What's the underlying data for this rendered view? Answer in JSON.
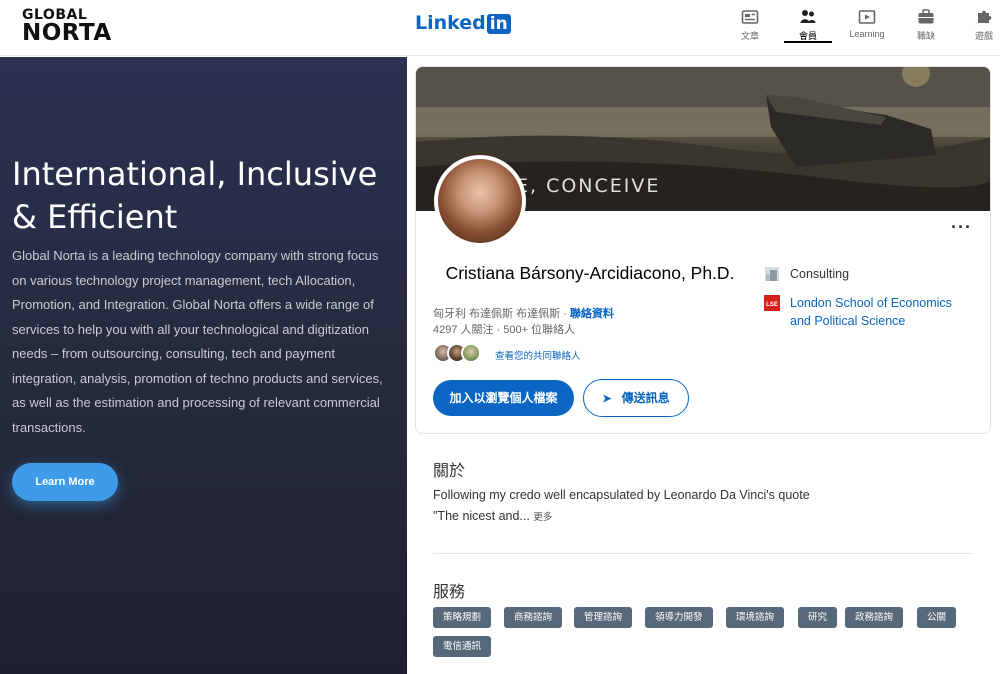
{
  "topbar": {
    "brand_line1": "GLOBAL",
    "brand_line2": "NORTA",
    "linkedin_text": "Linked",
    "linkedin_in": "in",
    "nav": [
      {
        "label": "文章",
        "icon": "article-icon"
      },
      {
        "label": "會員",
        "icon": "people-icon",
        "active": true
      },
      {
        "label": "Learning",
        "icon": "learning-icon"
      },
      {
        "label": "職缺",
        "icon": "briefcase-icon"
      },
      {
        "label": "遊戲",
        "icon": "puzzle-icon"
      }
    ]
  },
  "hero": {
    "title": "International, Inclusive & Efficient",
    "description": "Global Norta is a leading technology company with strong focus on various technology project management, tech Allocation, Promotion, and Integration. Global Norta offers a wide range of services to help you with all your technological and digitization needs – from outsourcing, consulting, tech and payment integration, analysis, promotion of techno products and services, as well as the estimation and processing of relevant commercial transactions.",
    "button": "Learn More"
  },
  "profile": {
    "cover_text": "E, CONCEIVE",
    "name": "Cristiana Bársony-Arcidiacono, Ph.D.",
    "location": "匈牙利 布達佩斯 布達佩斯",
    "separator": "·",
    "contact_link": "聯絡資料",
    "stats": "4297 人關注 · 500+ 位聯絡人",
    "mutual": "查看您的共同聯絡人",
    "primary_button": "加入以瀏覽個人檔案",
    "message_button": "傳送訊息",
    "company": "Consulting",
    "school": "London School of Economics and Political Science",
    "school_logo": "LSE",
    "more": "···"
  },
  "about": {
    "heading": "關於",
    "line1": "Following my credo well encapsulated by Leonardo Da Vinci's quote",
    "line2": "\"The nicest and...",
    "more": "更多"
  },
  "services": {
    "heading": "服務",
    "tags": [
      "策略規劃",
      "商務諮詢",
      "管理諮詢",
      "領導力開發",
      "環境諮詢",
      "研究",
      "政務諮詢",
      "公關",
      "電信通訊"
    ]
  },
  "colors": {
    "linkedin_blue": "#0a66c2",
    "hero_bg": "#2b3252",
    "learn_more": "#3d9be9",
    "tag_bg": "#56687a"
  }
}
